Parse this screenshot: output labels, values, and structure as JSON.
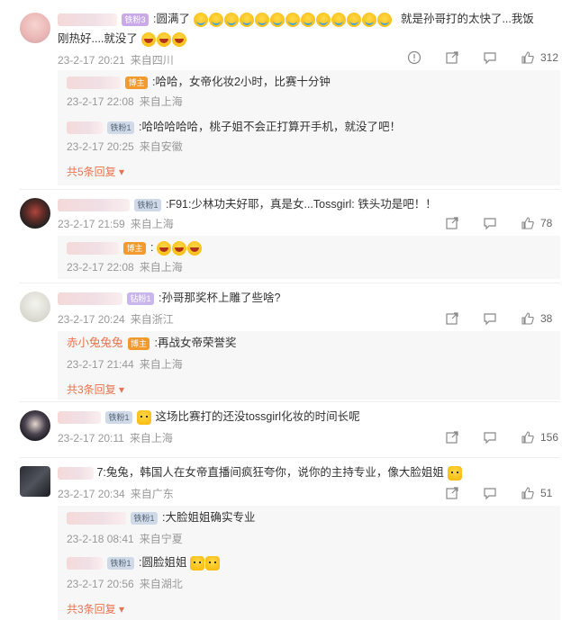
{
  "comments": [
    {
      "badge": "铁粉3",
      "text": ":圆满了",
      "text_tail": "就是孙哥打的太快了...我饭",
      "text_line2": "刚热好....就没了",
      "time": "23-2-17 20:21",
      "location": "来自四川",
      "likes": "312",
      "replies": [
        {
          "badge": "博主",
          "text": ":哈哈，女帝化妆2小时，比赛十分钟",
          "time": "23-2-17 22:08",
          "location": "来自上海"
        },
        {
          "badge": "铁粉1",
          "text": ":哈哈哈哈哈，桃子姐不会正打算开手机，就没了吧！",
          "time": "23-2-17 20:25",
          "location": "来自安徽"
        }
      ],
      "more": "共5条回复"
    },
    {
      "badge": "铁粉1",
      "text": ":F91:少林功夫好耶，真是女...Tossgirl: 铁头功是吧！！",
      "time": "23-2-17 21:59",
      "location": "来自上海",
      "likes": "78",
      "replies": [
        {
          "badge": "博主",
          "text": ":",
          "time": "23-2-17 22:08",
          "location": "来自上海"
        }
      ]
    },
    {
      "badge": "钻粉1",
      "text": ":孙哥那奖杯上雕了些啥?",
      "time": "23-2-17 20:24",
      "location": "来自浙江",
      "likes": "38",
      "replies": [
        {
          "name": "赤小兔兔兔",
          "badge": "博主",
          "text": ":再战女帝荣誉奖",
          "time": "23-2-17 21:44",
          "location": "来自上海"
        }
      ],
      "more": "共3条回复"
    },
    {
      "badge": "铁粉1",
      "text": "这场比赛打的还没tossgirl化妆的时间长呢",
      "time": "23-2-17 20:11",
      "location": "来自上海",
      "likes": "156"
    },
    {
      "text": "7:兔兔，韩国人在女帝直播间疯狂夸你，说你的主持专业，像大脸姐姐",
      "time": "23-2-17 20:34",
      "location": "来自广东",
      "likes": "51",
      "replies": [
        {
          "badge": "铁粉1",
          "text": ":大脸姐姐确实专业",
          "time": "23-2-18 08:41",
          "location": "来自宁夏"
        },
        {
          "badge": "铁粉1",
          "text": ":圆脸姐姐",
          "time": "23-2-17 20:56",
          "location": "来自湖北"
        }
      ],
      "more": "共3条回复"
    }
  ],
  "icons": {
    "report": "info-icon",
    "share": "share-icon",
    "comment": "comment-icon",
    "like": "thumbs-up-icon"
  },
  "colors": {
    "link": "#eb7350",
    "meta": "#999999",
    "host_badge": "#f29a2e"
  }
}
